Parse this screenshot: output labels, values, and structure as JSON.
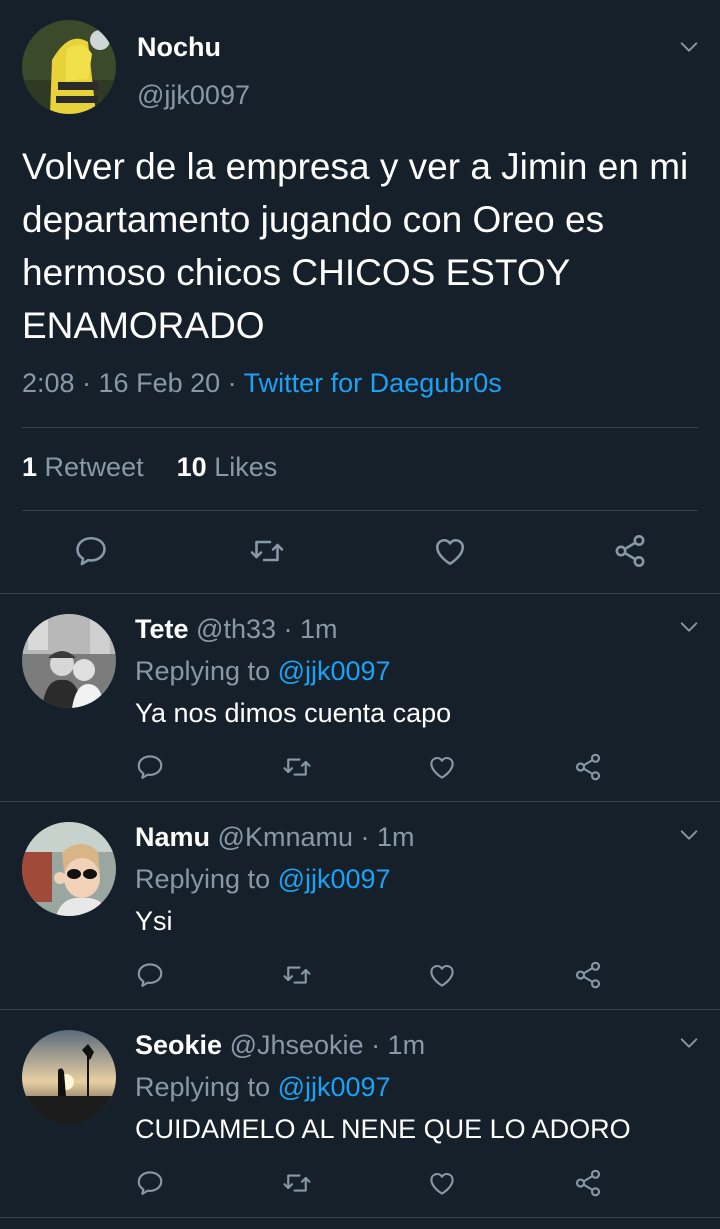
{
  "tweet": {
    "name": "Nochu",
    "handle": "@jjk0097",
    "text": "Volver de la empresa y ver a Jimin en mi departamento jugando con Oreo es hermoso chicos CHICOS ESTOY ENAMORADO",
    "time": "2:08 · 16 Feb 20 · ",
    "source": "Twitter for Daegubr0s",
    "retweets_count": "1",
    "retweets_label": "Retweet",
    "likes_count": "10",
    "likes_label": "Likes"
  },
  "replies": [
    {
      "name": "Tete",
      "handle": "@th33",
      "time": " · 1m",
      "replying_label": "Replying to ",
      "replying_to": "@jjk0097",
      "text": "Ya nos dimos cuenta capo"
    },
    {
      "name": "Namu",
      "handle": "@Kmnamu",
      "time": " · 1m",
      "replying_label": "Replying to ",
      "replying_to": "@jjk0097",
      "text": "Ysi"
    },
    {
      "name": "Seokie",
      "handle": "@Jhseokie",
      "time": " · 1m",
      "replying_label": "Replying to ",
      "replying_to": "@jjk0097",
      "text": "CUIDAMELO AL NENE QUE LO ADORO"
    }
  ],
  "icons": {
    "reply": "reply-icon",
    "retweet": "retweet-icon",
    "like": "like-icon",
    "share": "share-icon",
    "more": "chevron-down-icon"
  },
  "colors": {
    "background": "#15202b",
    "link": "#1da1f2",
    "muted": "#8899a6",
    "divider": "#38444d"
  }
}
